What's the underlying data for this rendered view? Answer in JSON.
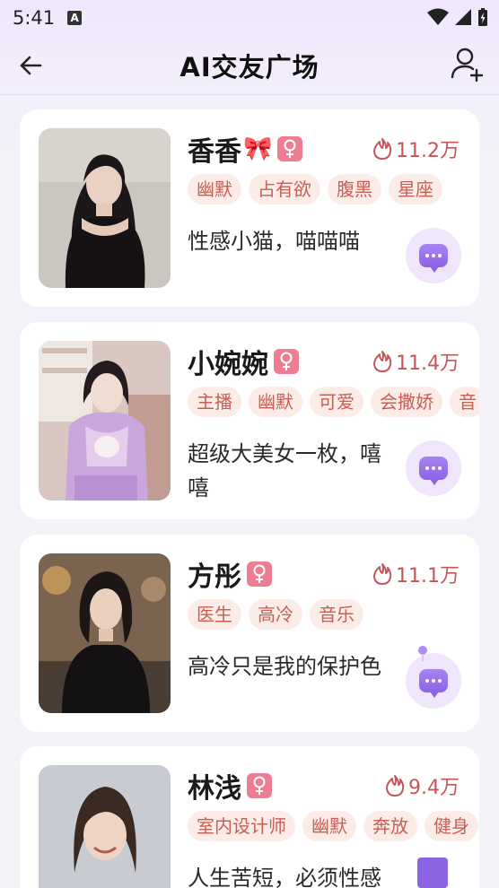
{
  "status_bar": {
    "time": "5:41",
    "notification_letter": "A"
  },
  "header": {
    "title": "AI交友广场"
  },
  "profiles": [
    {
      "name": "香香",
      "name_decoration": "🎀",
      "gender_symbol": "♀",
      "heat": "11.2万",
      "tags": [
        "幽默",
        "占有欲",
        "腹黑",
        "星座"
      ],
      "description": "性感小猫，喵喵喵"
    },
    {
      "name": "小婉婉",
      "name_decoration": "",
      "gender_symbol": "♀",
      "heat": "11.4万",
      "tags": [
        "主播",
        "幽默",
        "可爱",
        "会撒娇",
        "音"
      ],
      "description": "超级大美女一枚，嘻嘻"
    },
    {
      "name": "方彤",
      "name_decoration": "",
      "gender_symbol": "♀",
      "heat": "11.1万",
      "tags": [
        "医生",
        "高冷",
        "音乐"
      ],
      "description": "高冷只是我的保护色"
    },
    {
      "name": "林浅",
      "name_decoration": "",
      "gender_symbol": "♀",
      "heat": "9.4万",
      "tags": [
        "室内设计师",
        "幽默",
        "奔放",
        "健身"
      ],
      "description": "人生苦短，必须性感"
    }
  ],
  "colors": {
    "accent_purple": "#8b64e6",
    "tag_bg": "#fbece7",
    "tag_text": "#c85e53",
    "gender_badge": "#ee7d93",
    "heat_text": "#c6555a"
  },
  "icons": {
    "back": "arrow-left-icon",
    "add_friend": "user-plus-icon",
    "heat": "flame-icon",
    "chat": "chat-bubble-icon",
    "gender": "female-icon"
  }
}
